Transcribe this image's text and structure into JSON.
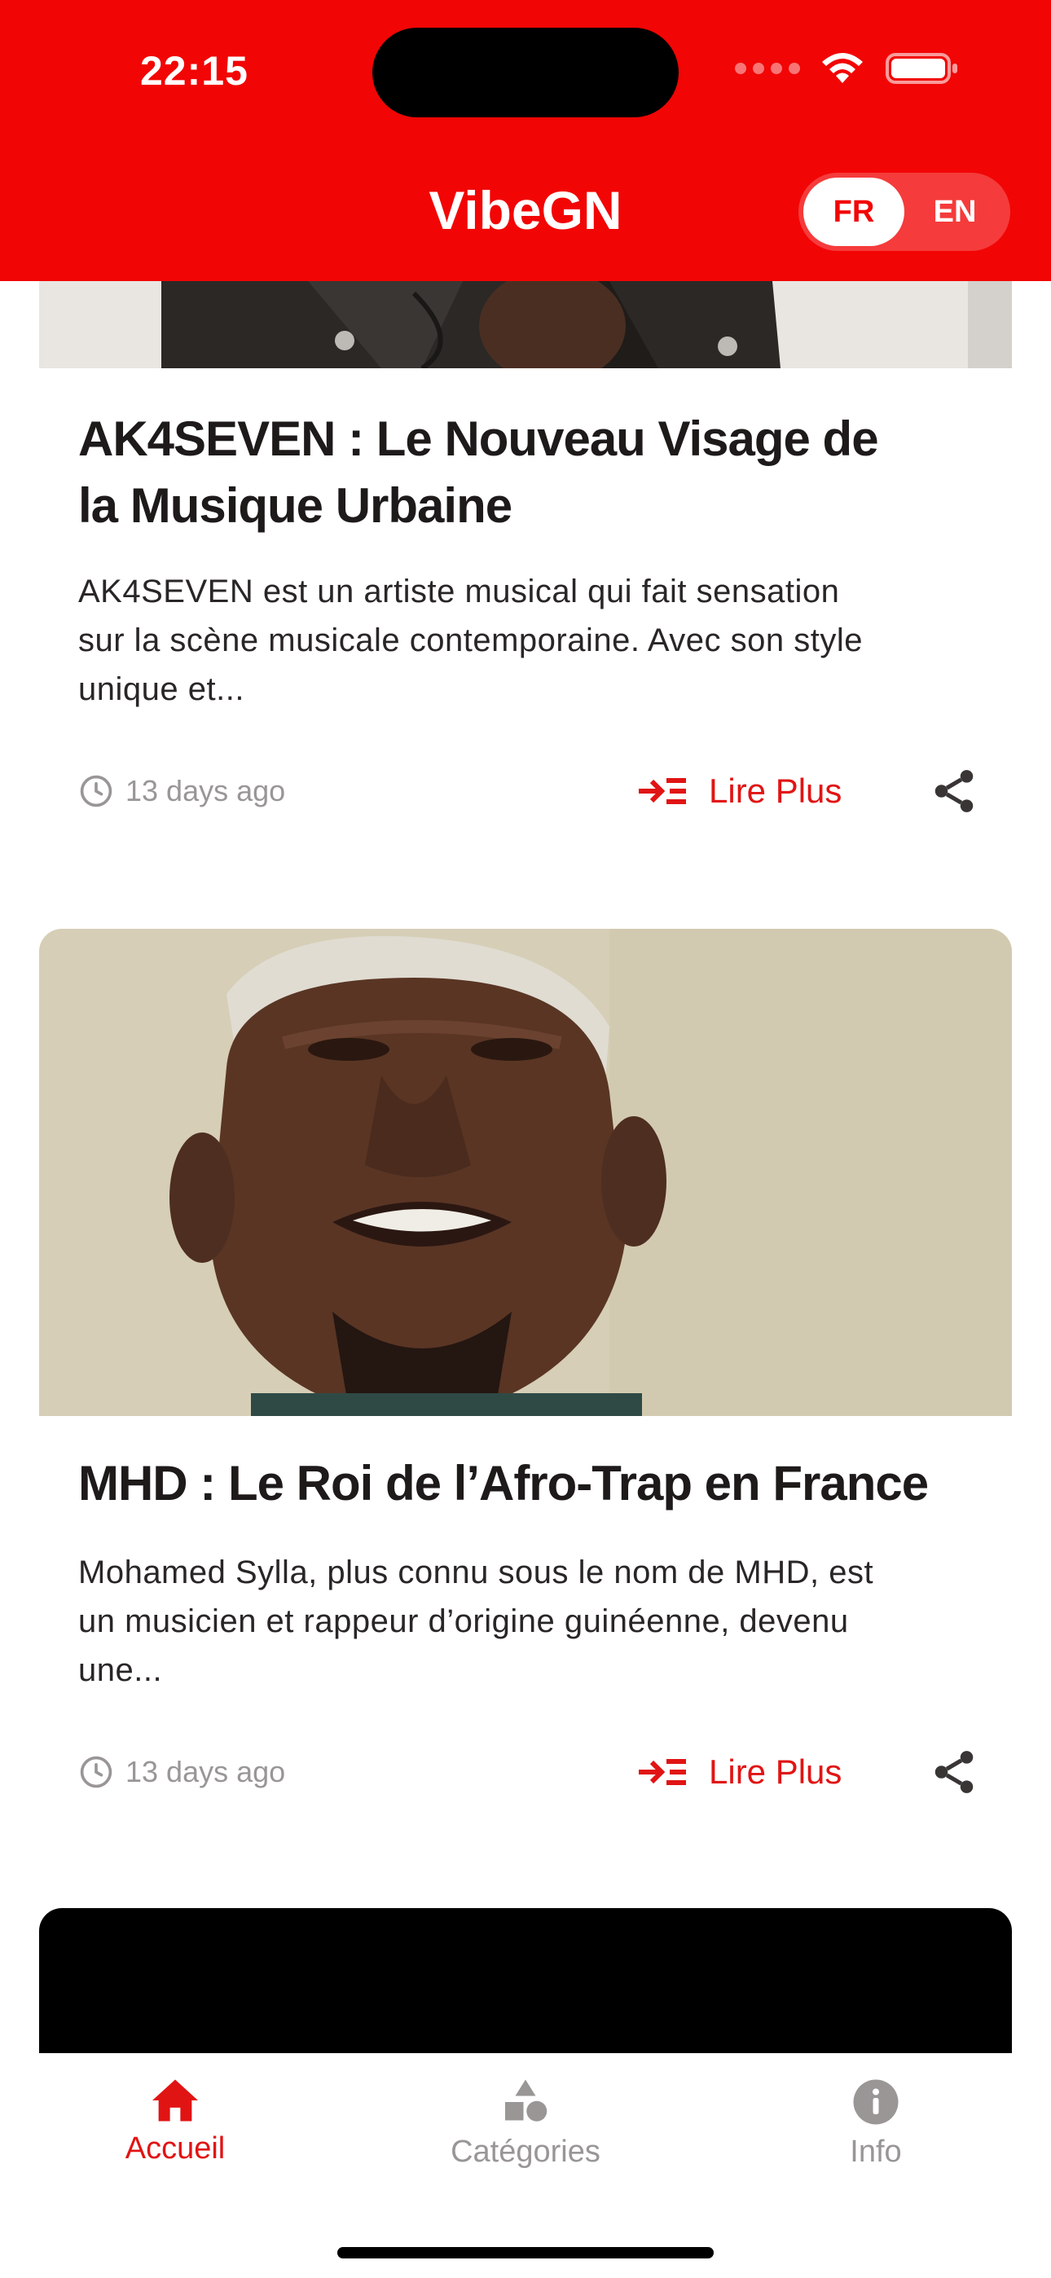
{
  "status_bar": {
    "time": "22:15"
  },
  "header": {
    "title": "VibeGN",
    "languages": [
      {
        "code": "FR",
        "active": true
      },
      {
        "code": "EN",
        "active": false
      }
    ]
  },
  "articles": [
    {
      "title_lines": [
        "AK4SEVEN : Le Nouveau Visage de",
        "la Musique Urbaine"
      ],
      "excerpt_lines": [
        "AK4SEVEN est un artiste musical qui fait sensation",
        "sur la scène musicale contemporaine. Avec son style",
        "unique et..."
      ],
      "time": "13 days ago",
      "read_more": "Lire Plus"
    },
    {
      "title_lines": [
        "MHD : Le Roi de l’Afro-Trap en France"
      ],
      "excerpt_lines": [
        "Mohamed Sylla, plus connu sous le nom de MHD, est",
        "un musicien et rappeur d’origine guinéenne, devenu",
        "une..."
      ],
      "time": "13 days ago",
      "read_more": "Lire Plus"
    }
  ],
  "tabbar": {
    "tabs": [
      {
        "label": "Accueil",
        "icon": "home-icon",
        "active": true
      },
      {
        "label": "Catégories",
        "icon": "shapes-icon",
        "active": false
      },
      {
        "label": "Info",
        "icon": "info-icon",
        "active": false
      }
    ]
  },
  "colors": {
    "brand": "#f20505",
    "active_tab": "#e11414",
    "inactive_tab": "#9a9696"
  }
}
